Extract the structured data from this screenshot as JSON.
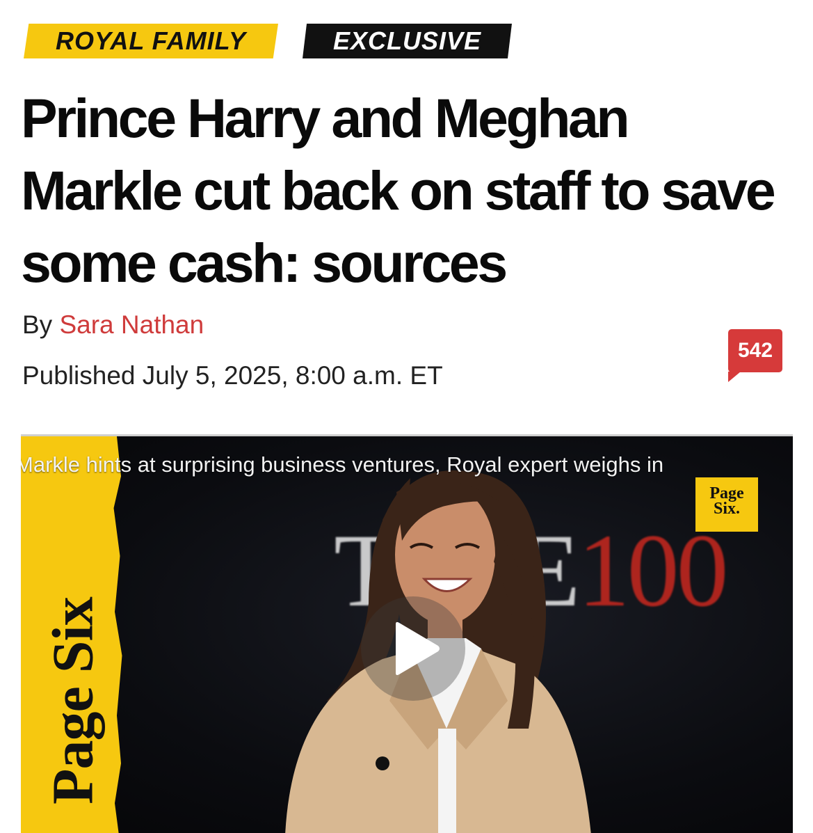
{
  "tags": {
    "category": "ROYAL FAMILY",
    "exclusive": "EXCLUSIVE"
  },
  "headline": "Prince Harry and Meghan Markle cut back on staff to save some cash: sources",
  "byline": {
    "prefix": "By ",
    "author": "Sara Nathan"
  },
  "published": "Published July 5, 2025, 8:00 a.m. ET",
  "comments": {
    "count": "542",
    "icon": "comment-bubble-icon"
  },
  "video": {
    "title": "Markle hints at surprising business ventures, Royal expert weighs in",
    "brand_strip": "Page Six",
    "corner_logo_line1": "Page",
    "corner_logo_line2": "Six.",
    "backdrop_letters": "TIME",
    "backdrop_number": "100",
    "play_icon": "play-icon"
  },
  "colors": {
    "brand_yellow": "#f6c810",
    "accent_red": "#cf3b3b",
    "badge_red": "#d63a3a"
  }
}
